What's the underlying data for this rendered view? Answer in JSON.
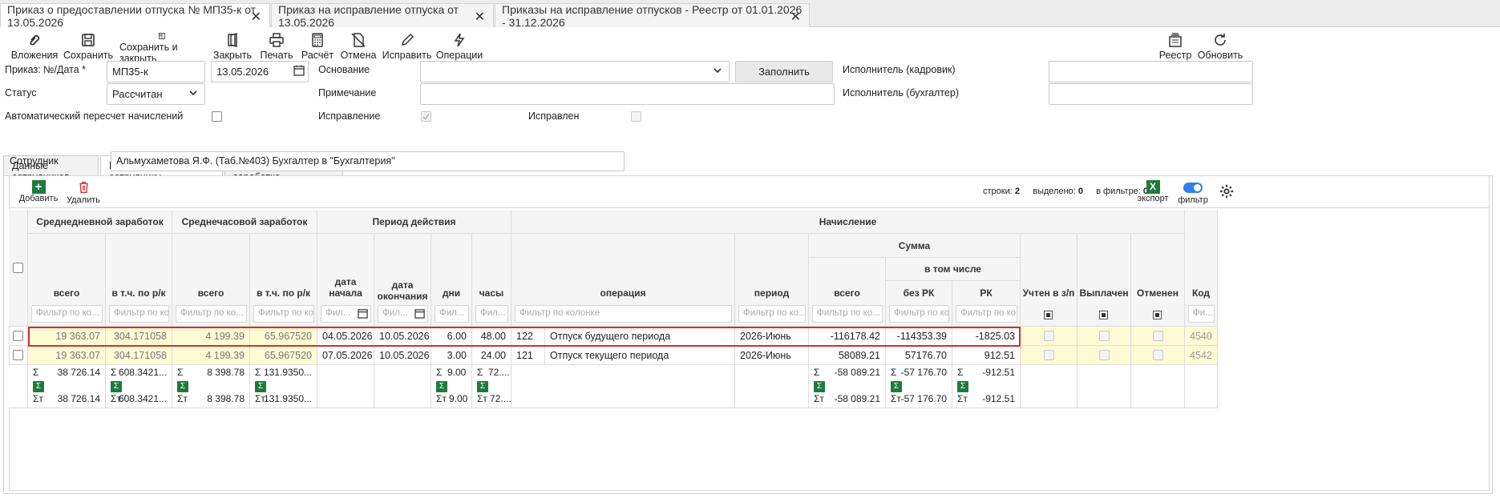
{
  "tabs": [
    {
      "label": "Приказ о предоставлении отпуска № МП35-к от 13.05.2026",
      "active": true
    },
    {
      "label": "Приказ на исправление отпуска от 13.05.2026",
      "active": false
    },
    {
      "label": "Приказы на исправление отпусков - Реестр от 01.01.2026 - 31.12.2026",
      "active": false
    }
  ],
  "toolbar": {
    "attachments": "Вложения",
    "save": "Сохранить",
    "save_close": "Сохранить и закрыть",
    "close": "Закрыть",
    "print": "Печать",
    "calc": "Расчёт",
    "cancel": "Отмена",
    "fix": "Исправить",
    "operations": "Операции",
    "registry": "Реестр",
    "refresh": "Обновить"
  },
  "form": {
    "order_label": "Приказ: №/Дата *",
    "order_no": "МП35-к",
    "order_date": "13.05.2026",
    "basis_label": "Основание",
    "basis_value": "",
    "fill_button": "Заполнить",
    "exec_hr_label": "Исполнитель (кадровик)",
    "status_label": "Статус",
    "status_value": "Рассчитан",
    "note_label": "Примечание",
    "exec_acc_label": "Исполнитель (бухгалтер)",
    "auto_recalc_label": "Автоматический пересчет начислений",
    "correction_label": "Исправление",
    "corrected_label": "Исправлен"
  },
  "inner_tabs": [
    "Данные сотрудников",
    "Все операции по сотруднику",
    "Расчёт среднего заработка"
  ],
  "employee": {
    "label": "Сотрудник",
    "value": "Альмухаметова Я.Ф. (Таб.№403) Бухгалтер в \"Бухгалтерия\""
  },
  "grid_toolbar": {
    "add": "Добавить",
    "delete": "Удалить",
    "rows_label": "строки:",
    "rows_value": "2",
    "selected_label": "выделено:",
    "selected_value": "0",
    "filter_label": "в фильтре:",
    "filter_value": "0",
    "export": "экспорт",
    "filter": "фильтр"
  },
  "headers": {
    "avg_daily": "Среднедневной заработок",
    "avg_hourly": "Среднечасовой заработок",
    "period": "Период действия",
    "accrual": "Начисление",
    "sum": "Сумма",
    "incl": "в том числе",
    "total": "всего",
    "incl_rk": "в т.ч. по р/к",
    "date_start": "дата начала",
    "date_end": "дата окончания",
    "days": "дни",
    "hours": "часы",
    "operation": "операция",
    "accr_period": "период",
    "without_rk": "без РК",
    "rk": "РК",
    "counted": "Учтен в з/п",
    "paid": "Выплачен",
    "cancelled": "Отменен",
    "code": "Код"
  },
  "filters": {
    "by_col": "Фильтр по колонке",
    "by_col_short": "Фильтр по ко...",
    "date_short": "Фил...",
    "fi": "Фи..."
  },
  "rows": [
    {
      "daily_total": "19 363.07",
      "daily_rk": "304.171058",
      "hourly_total": "4 199.39",
      "hourly_rk": "65.967520",
      "start": "04.05.2026",
      "end": "10.05.2026",
      "days": "6.00",
      "hours": "48.00",
      "op_code": "122",
      "op_name": "Отпуск будущего периода",
      "period": "2026-Июнь",
      "sum_total": "-116178.42",
      "sum_no_rk": "-114353.39",
      "sum_rk": "-1825.03",
      "code": "4540"
    },
    {
      "daily_total": "19 363.07",
      "daily_rk": "304.171058",
      "hourly_total": "4 199.39",
      "hourly_rk": "65.967520",
      "start": "07.05.2026",
      "end": "10.05.2026",
      "days": "3.00",
      "hours": "24.00",
      "op_code": "121",
      "op_name": "Отпуск текущего периода",
      "period": "2026-Июнь",
      "sum_total": "58089.21",
      "sum_no_rk": "57176.70",
      "sum_rk": "912.51",
      "code": "4542"
    }
  ],
  "totals": {
    "sigma": "Σ",
    "sigma_t": "Σт",
    "daily_total": "38 726.14",
    "daily_rk": "608.3421...",
    "hourly_total": "8 398.78",
    "hourly_rk": "131.9350...",
    "days": "9.00",
    "hours": "72....",
    "sum_total": "-58 089.21",
    "sum_no_rk": "-57 176.70",
    "sum_rk": "-912.51"
  }
}
